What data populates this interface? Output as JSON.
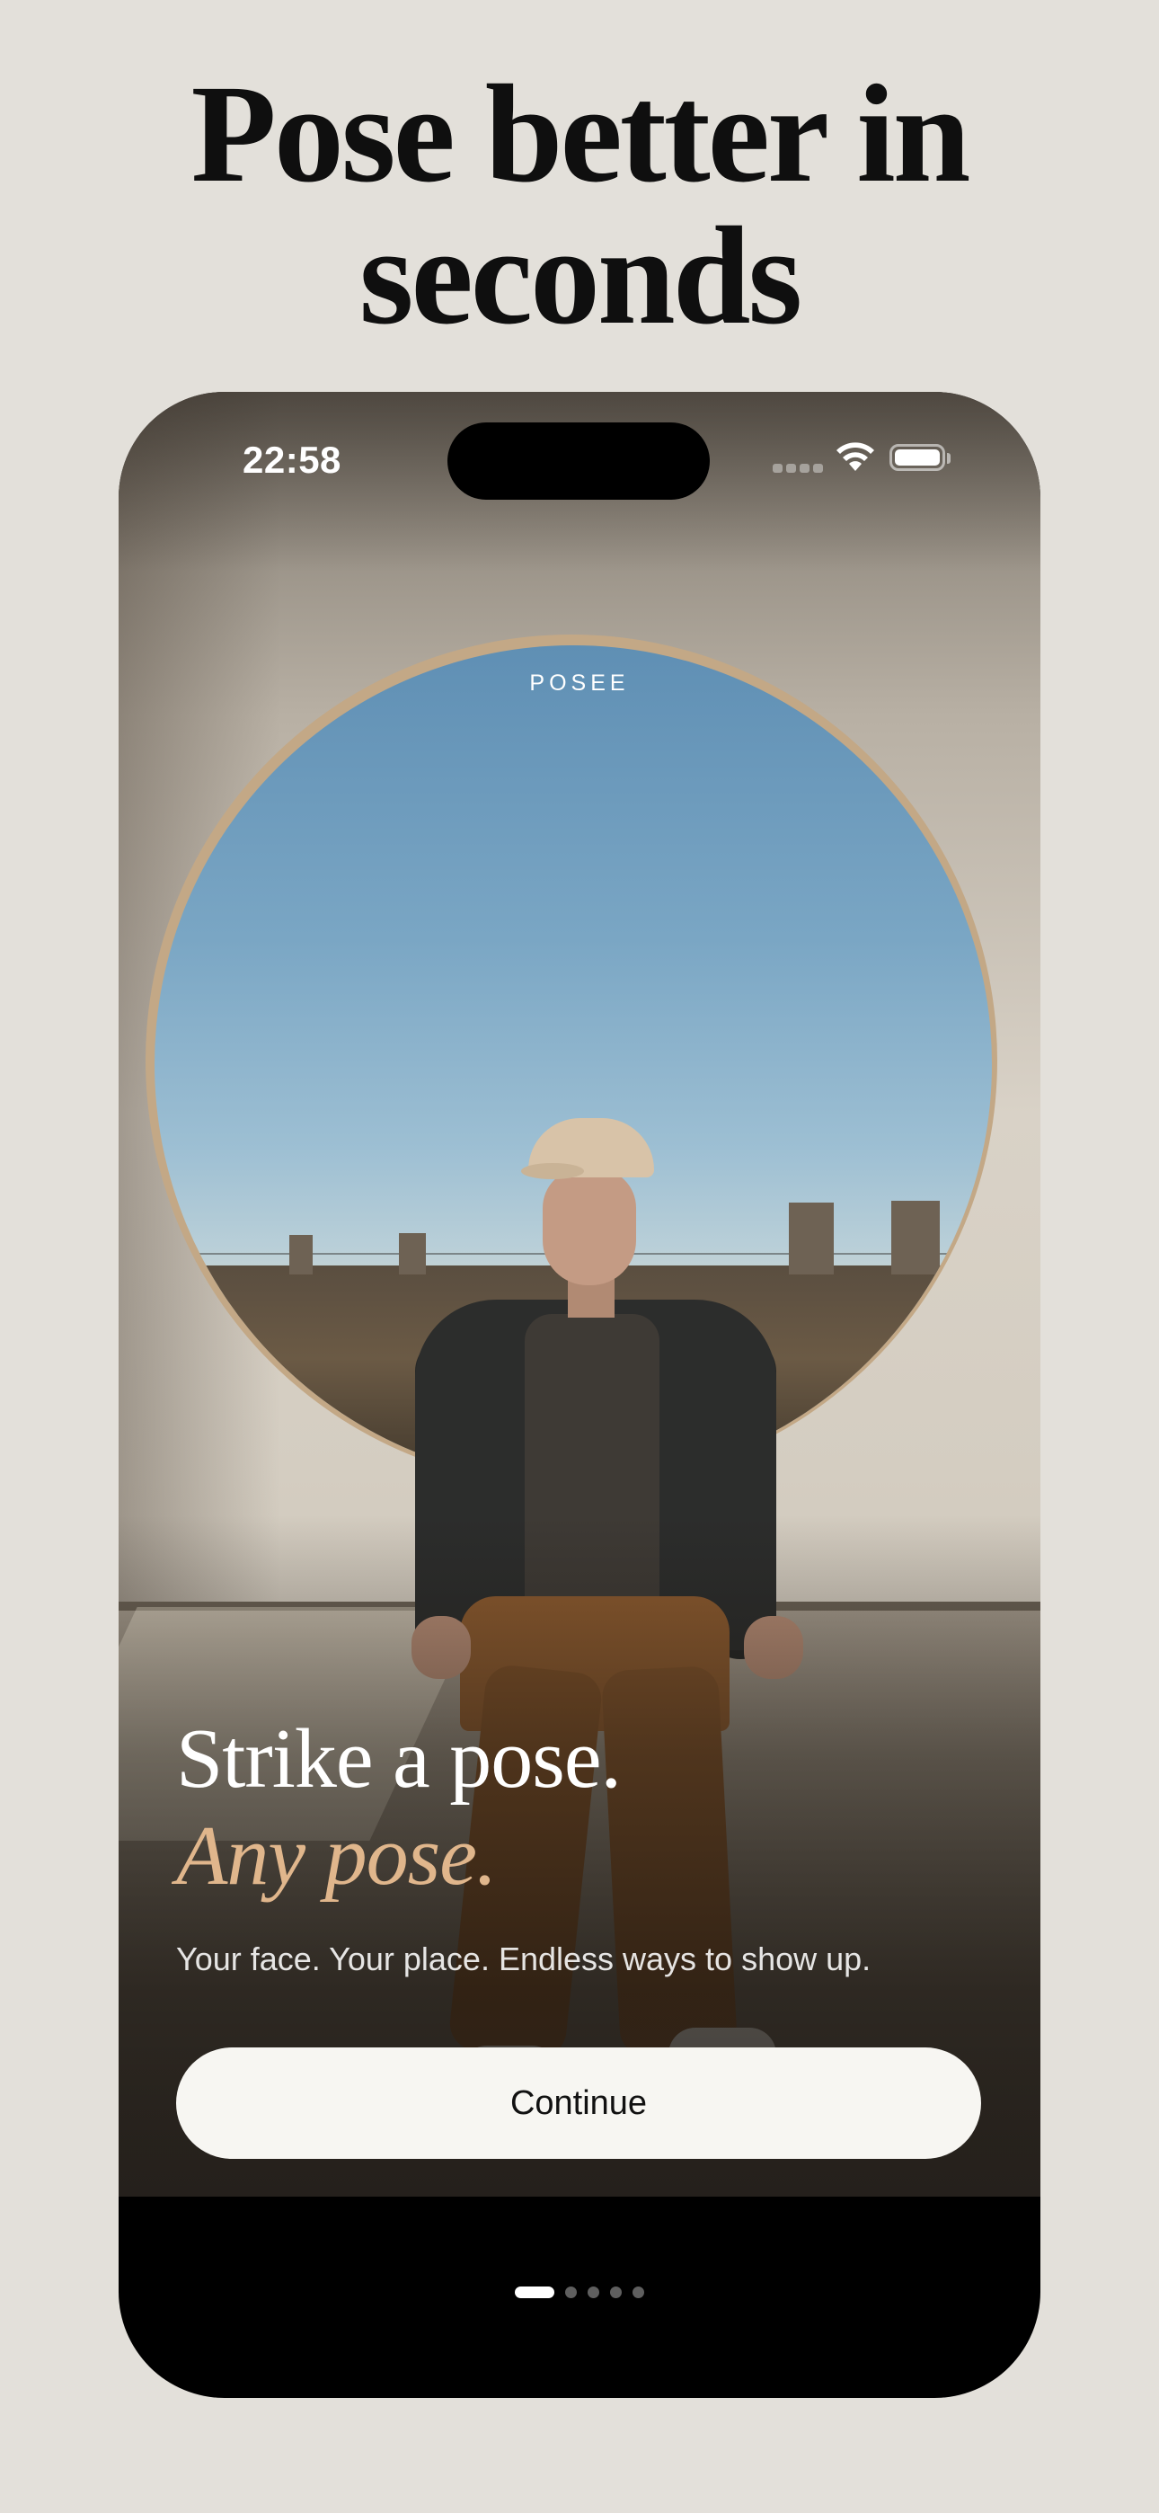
{
  "marketing": {
    "headline_line1": "Pose better in",
    "headline_line2": "seconds"
  },
  "status_bar": {
    "time": "22:58",
    "icons": [
      "signal-icon",
      "wifi-icon",
      "battery-icon"
    ]
  },
  "app": {
    "brand": "POSEE"
  },
  "onboarding": {
    "title": "Strike a pose.",
    "title_accent": "Any pose.",
    "subtitle": "Your face. Your place. Endless ways to show up.",
    "continue_label": "Continue",
    "page_index": 1,
    "page_count": 5
  },
  "colors": {
    "background": "#e3e0da",
    "accent": "#e0b68c",
    "button": "#f7f6f2",
    "phone": "#000000"
  }
}
